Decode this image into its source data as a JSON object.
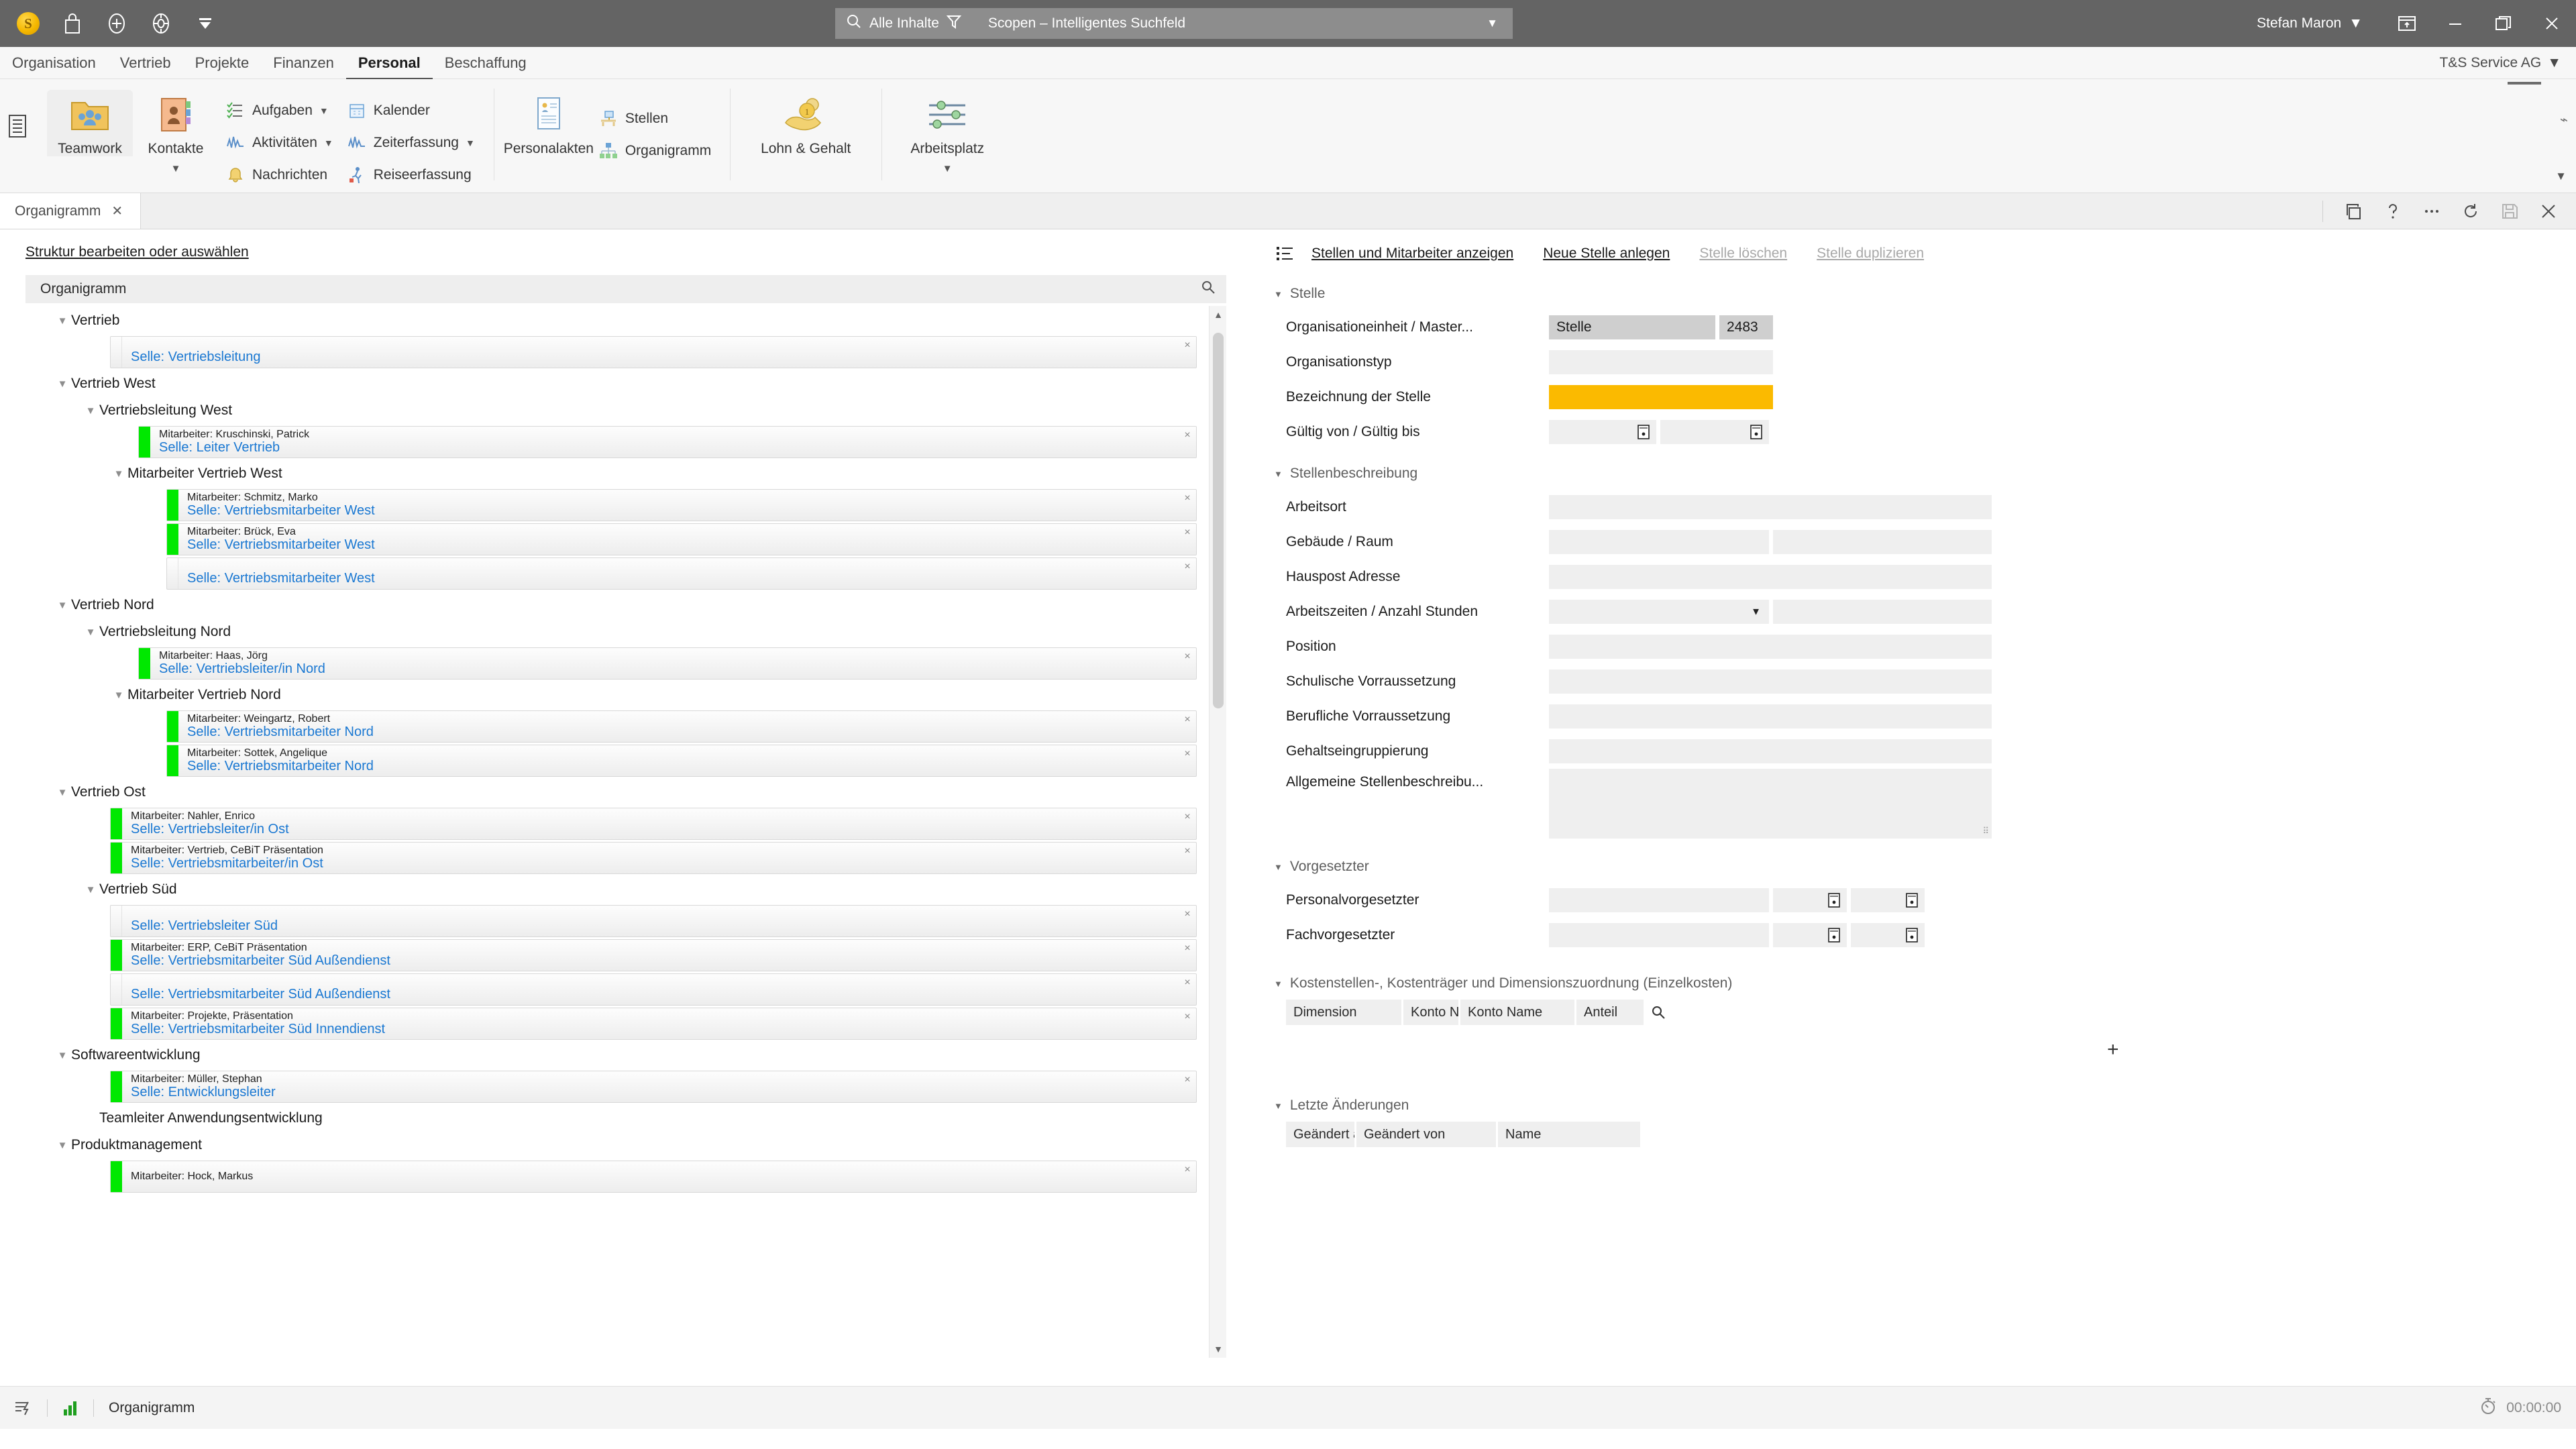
{
  "titlebar": {
    "logo_text": "S",
    "icons": [
      "bag-icon",
      "plus-circle-icon",
      "lifebuoy-icon",
      "filter-down-icon"
    ],
    "search": {
      "scope_label": "Alle Inhalte",
      "scope_icon": "magnifier-icon",
      "filter_icon": "funnel-icon",
      "value": "Scopen – Intelligentes Suchfeld",
      "caret": "▼"
    },
    "user": "Stefan Maron",
    "user_caret": "▼",
    "window_buttons": [
      "restore-window-icon",
      "minimize-icon",
      "maximize-icon",
      "close-icon"
    ]
  },
  "menubar": {
    "items": [
      {
        "label": "Organisation",
        "active": false
      },
      {
        "label": "Vertrieb",
        "active": false
      },
      {
        "label": "Projekte",
        "active": false
      },
      {
        "label": "Finanzen",
        "active": false
      },
      {
        "label": "Personal",
        "active": true
      },
      {
        "label": "Beschaffung",
        "active": false
      }
    ],
    "company": "T&S Service AG",
    "company_caret": "▼"
  },
  "ribbon": {
    "group1": {
      "teamwork": "Teamwork",
      "kontakte": "Kontakte",
      "kontakte_caret": "▼",
      "small": [
        {
          "label": "Aufgaben",
          "caret": "▼",
          "icon": "tasklist-icon"
        },
        {
          "label": "Aktivitäten",
          "caret": "▼",
          "icon": "activity-icon"
        },
        {
          "label": "Nachrichten",
          "caret": "",
          "icon": "bell-icon"
        },
        {
          "label": "Kalender",
          "caret": "",
          "icon": "calendar-icon"
        },
        {
          "label": "Zeiterfassung",
          "caret": "▼",
          "icon": "activity-icon"
        },
        {
          "label": "Reiseerfassung",
          "caret": "",
          "icon": "traveler-icon"
        }
      ]
    },
    "group2": {
      "personalakten": "Personalakten",
      "stellen": "Stellen",
      "organigramm": "Organigramm"
    },
    "group3": {
      "lohn": "Lohn & Gehalt"
    },
    "group4": {
      "arbeitsplatz": "Arbeitsplatz",
      "caret": "▼"
    }
  },
  "tabstrip": {
    "tab_label": "Organigramm",
    "tab_close": "✕",
    "buttons": [
      "copy-icon",
      "help-icon",
      "more-icon",
      "refresh-icon",
      "save-icon",
      "close-icon"
    ]
  },
  "left": {
    "edit_link": "Struktur bearbeiten oder auswählen",
    "tree_title": "Organigramm",
    "tree_search_icon": "magnifier-icon",
    "nodes": [
      {
        "type": "node",
        "depth": 1,
        "label": "Vertrieb",
        "caret": "▼"
      },
      {
        "type": "card",
        "depth": 3,
        "employee": "",
        "role": "Selle: Vertriebsleitung",
        "bar": false
      },
      {
        "type": "node",
        "depth": 1,
        "label": "Vertrieb West",
        "caret": "▼"
      },
      {
        "type": "node",
        "depth": 2,
        "label": "Vertriebsleitung West",
        "caret": "▼"
      },
      {
        "type": "card",
        "depth": 4,
        "employee": "Mitarbeiter: Kruschinski, Patrick",
        "role": "Selle: Leiter Vertrieb",
        "bar": true
      },
      {
        "type": "node",
        "depth": 3,
        "label": "Mitarbeiter Vertrieb West",
        "caret": "▼"
      },
      {
        "type": "card",
        "depth": 5,
        "employee": "Mitarbeiter: Schmitz, Marko",
        "role": "Selle: Vertriebsmitarbeiter West",
        "bar": true
      },
      {
        "type": "card",
        "depth": 5,
        "employee": "Mitarbeiter: Brück, Eva",
        "role": "Selle: Vertriebsmitarbeiter West",
        "bar": true
      },
      {
        "type": "card",
        "depth": 5,
        "employee": "",
        "role": "Selle: Vertriebsmitarbeiter West",
        "bar": false
      },
      {
        "type": "node",
        "depth": 1,
        "label": "Vertrieb Nord",
        "caret": "▼"
      },
      {
        "type": "node",
        "depth": 2,
        "label": "Vertriebsleitung Nord",
        "caret": "▼"
      },
      {
        "type": "card",
        "depth": 4,
        "employee": "Mitarbeiter: Haas, Jörg",
        "role": "Selle: Vertriebsleiter/in Nord",
        "bar": true
      },
      {
        "type": "node",
        "depth": 3,
        "label": "Mitarbeiter Vertrieb Nord",
        "caret": "▼"
      },
      {
        "type": "card",
        "depth": 5,
        "employee": "Mitarbeiter: Weingartz, Robert",
        "role": "Selle: Vertriebsmitarbeiter Nord",
        "bar": true
      },
      {
        "type": "card",
        "depth": 5,
        "employee": "Mitarbeiter: Sottek, Angelique",
        "role": "Selle: Vertriebsmitarbeiter Nord",
        "bar": true
      },
      {
        "type": "node",
        "depth": 1,
        "label": "Vertrieb Ost",
        "caret": "▼"
      },
      {
        "type": "card",
        "depth": 3,
        "employee": "Mitarbeiter: Nahler, Enrico",
        "role": "Selle: Vertriebsleiter/in Ost",
        "bar": true
      },
      {
        "type": "card",
        "depth": 3,
        "employee": "Mitarbeiter: Vertrieb, CeBiT Präsentation",
        "role": "Selle: Vertriebsmitarbeiter/in Ost",
        "bar": true
      },
      {
        "type": "node",
        "depth": 2,
        "label": "Vertrieb Süd",
        "caret": "▼"
      },
      {
        "type": "card",
        "depth": 3,
        "employee": "",
        "role": "Selle: Vertriebsleiter Süd",
        "bar": false
      },
      {
        "type": "card",
        "depth": 3,
        "employee": "Mitarbeiter: ERP, CeBiT Präsentation",
        "role": "Selle: Vertriebsmitarbeiter Süd Außendienst",
        "bar": true
      },
      {
        "type": "card",
        "depth": 3,
        "employee": "",
        "role": "Selle: Vertriebsmitarbeiter Süd Außendienst",
        "bar": false
      },
      {
        "type": "card",
        "depth": 3,
        "employee": "Mitarbeiter: Projekte, Präsentation",
        "role": "Selle: Vertriebsmitarbeiter Süd Innendienst",
        "bar": true
      },
      {
        "type": "node",
        "depth": 1,
        "label": "Softwareentwicklung",
        "caret": "▼"
      },
      {
        "type": "card",
        "depth": 3,
        "employee": "Mitarbeiter: Müller, Stephan",
        "role": "Selle: Entwicklungsleiter",
        "bar": true
      },
      {
        "type": "node",
        "depth": 2,
        "label": "Teamleiter Anwendungsentwicklung",
        "caret": ""
      },
      {
        "type": "node",
        "depth": 1,
        "label": "Produktmanagement",
        "caret": "▼"
      },
      {
        "type": "card",
        "depth": 3,
        "employee": "Mitarbeiter: Hock, Markus",
        "role": "",
        "bar": true
      }
    ]
  },
  "right": {
    "actions": [
      {
        "label": "Stellen und Mitarbeiter anzeigen",
        "disabled": false
      },
      {
        "label": "Neue Stelle anlegen",
        "disabled": false
      },
      {
        "label": "Stelle löschen",
        "disabled": true
      },
      {
        "label": "Stelle duplizieren",
        "disabled": true
      }
    ],
    "sections": {
      "stelle": {
        "title": "Stelle",
        "caret": "▼",
        "rows": {
          "org_label": "Organisationeinheit / Master...",
          "org_value": "Stelle",
          "org_number": "2483",
          "typ_label": "Organisationstyp",
          "typ_value": "",
          "bez_label": "Bezeichnung der Stelle",
          "bez_value": "",
          "gueltig_label": "Gültig von / Gültig bis"
        }
      },
      "stellenbeschreibung": {
        "title": "Stellenbeschreibung",
        "caret": "▼",
        "labels": [
          "Arbeitsort",
          "Gebäude / Raum",
          "Hauspost Adresse",
          "Arbeitszeiten / Anzahl Stunden",
          "Position",
          "Schulische Vorraussetzung",
          "Berufliche Vorraussetzung",
          "Gehaltseingruppierung",
          "Allgemeine Stellenbeschreibu..."
        ]
      },
      "vorgesetzter": {
        "title": "Vorgesetzter",
        "caret": "▼",
        "labels": [
          "Personalvorgesetzter",
          "Fachvorgesetzter"
        ]
      },
      "kostenstellen": {
        "title": "Kostenstellen-, Kostenträger und Dimensionszuordnung (Einzelkosten)",
        "caret": "▼",
        "columns": [
          "Dimension",
          "Konto Num...",
          "Konto Name",
          "Anteil"
        ],
        "search_icon": "magnifier-icon",
        "add_icon": "+"
      },
      "letzte_aenderungen": {
        "title": "Letzte Änderungen",
        "caret": "▼",
        "columns": [
          "Geändert am",
          "Geändert von",
          "Name"
        ]
      }
    }
  },
  "statusbar": {
    "icons": [
      "flash-list-icon",
      "bars-chart-icon"
    ],
    "label": "Organigramm",
    "timer_icon": "stopwatch-icon",
    "timer": "00:00:00"
  }
}
